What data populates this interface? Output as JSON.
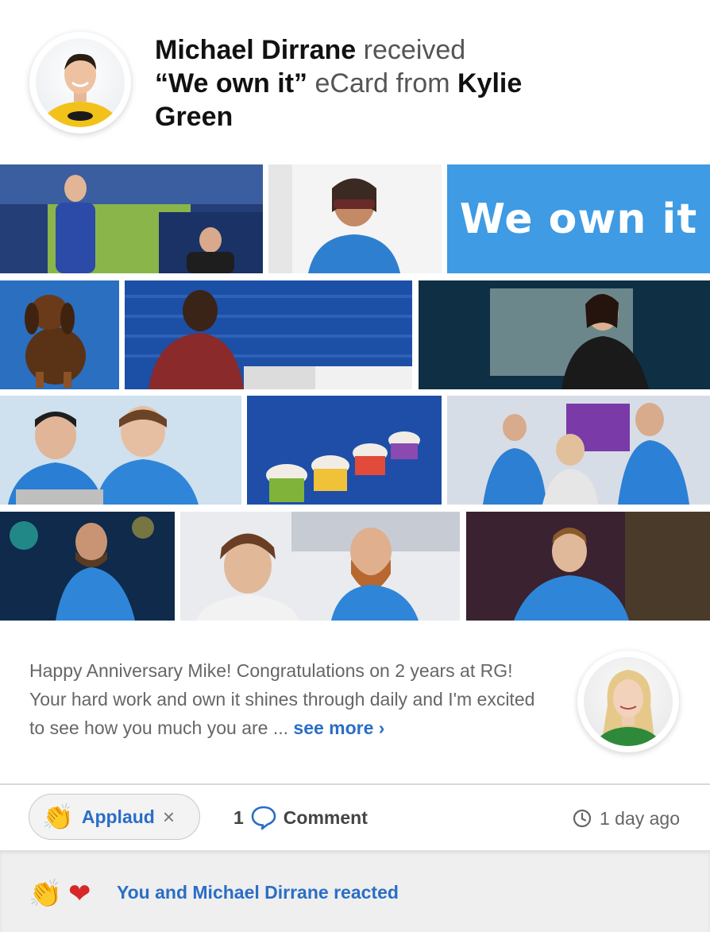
{
  "header": {
    "recipient": "Michael Dirrane",
    "received_text": "received",
    "ecard_name": "“We own it”",
    "ecard_text": "eCard from",
    "sender": "Kylie Green"
  },
  "ecard": {
    "banner_text": "We own it",
    "accent_color": "#3f9be3"
  },
  "message": {
    "text": "Happy Anniversary Mike! Congratulations on 2 years at RG! Your hard work and own it shines through daily and I'm excited to see how you much you are ...",
    "see_more_label": "see more ›"
  },
  "actions": {
    "applaud_icon": "👏",
    "applaud_label": "Applaud",
    "remove_icon": "×",
    "comment_count": "1",
    "comment_label": "Comment",
    "timestamp": "1 day ago"
  },
  "reactions": {
    "applaud_icon": "👏",
    "heart_icon": "❤",
    "summary": "You and Michael Dirrane reacted"
  },
  "colors": {
    "link": "#2a6ec6",
    "divider": "#d9d9d9",
    "footer_bg": "#efefef"
  }
}
